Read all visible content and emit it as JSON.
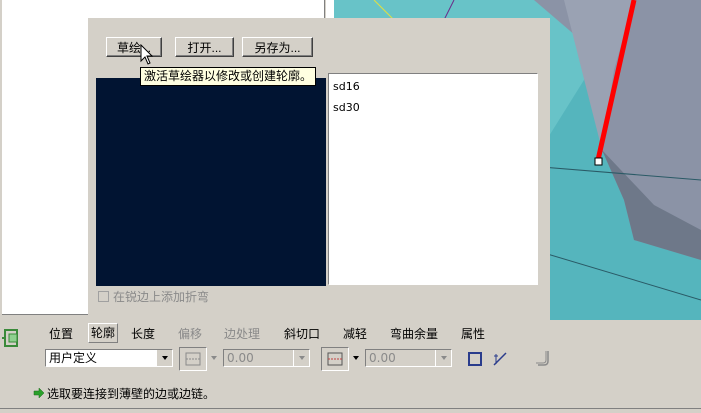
{
  "dialog": {
    "sketch_label": "草绘...",
    "open_label": "打开...",
    "saveas_label": "另存为...",
    "tooltip": "激活草绘器以修改或创建轮廓。",
    "sections": [
      {
        "label": "sd16"
      },
      {
        "label": "sd30"
      }
    ],
    "add_bend_label": "在锐边上添加折弯"
  },
  "dashboard": {
    "tabs": [
      {
        "label": "位置"
      },
      {
        "label": "轮廓"
      },
      {
        "label": "长度"
      },
      {
        "label": "偏移"
      },
      {
        "label": "边处理"
      },
      {
        "label": "斜切口"
      },
      {
        "label": "减轻"
      },
      {
        "label": "弯曲余量"
      },
      {
        "label": "属性"
      }
    ],
    "profile_type": "用户定义",
    "value1": "0.00",
    "value2": "0.00",
    "status_prompt": "选取要连接到薄壁的边或边链。"
  },
  "colors": {
    "preview_bg": "#011432",
    "viewport_teal": "#5db9c0",
    "edge_red": "#ff0000",
    "tooltip_bg": "#ffffe1"
  }
}
